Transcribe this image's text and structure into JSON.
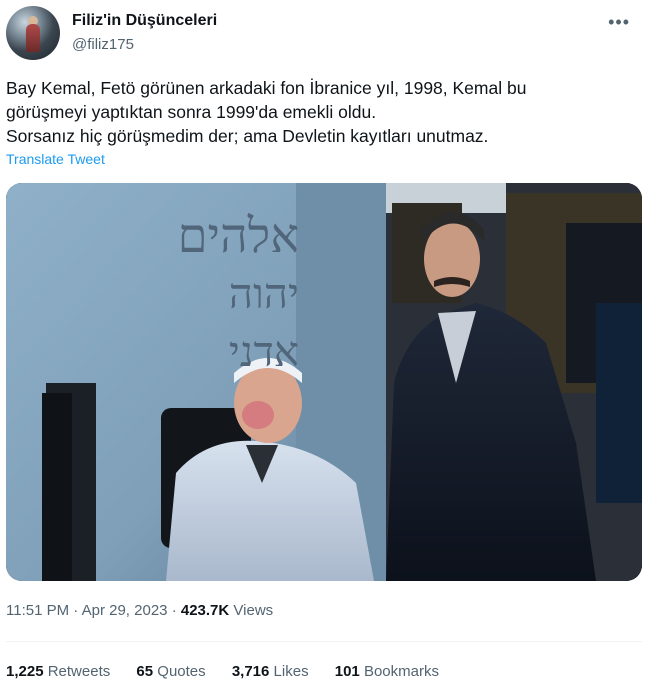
{
  "author": {
    "display_name": "Filiz'in Düşünceleri",
    "handle": "@filiz175"
  },
  "more_icon": "•••",
  "tweet": {
    "lines": [
      "Bay Kemal, Fetö görünen arkadaki fon İbranice yıl, 1998, Kemal bu",
      "görüşmeyi yaptıktan sonra 1999'da emekli oldu.",
      "Sorsanız hiç görüşmedim der; ama Devletin kayıtları unutmaz."
    ],
    "translate_label": "Translate Tweet"
  },
  "photo": {
    "hebrew_lines": [
      "אלהים",
      "יהוה",
      "אדני"
    ]
  },
  "meta": {
    "time": "11:51 PM",
    "separator": "·",
    "date": "Apr 29, 2023",
    "views_count": "423.7K",
    "views_label": "Views"
  },
  "stats": {
    "retweets_count": "1,225",
    "retweets_label": "Retweets",
    "quotes_count": "65",
    "quotes_label": "Quotes",
    "likes_count": "3,716",
    "likes_label": "Likes",
    "bookmarks_count": "101",
    "bookmarks_label": "Bookmarks"
  },
  "colors": {
    "link": "#1d9bf0",
    "secondary_text": "#536471",
    "primary_text": "#0f1419"
  }
}
